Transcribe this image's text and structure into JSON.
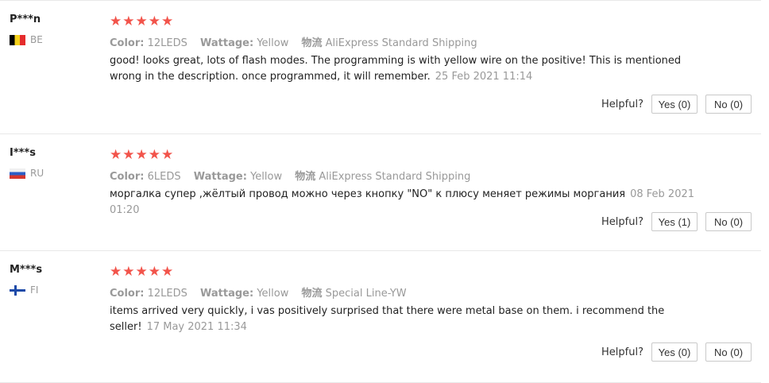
{
  "reviews": [
    {
      "user": "P***n",
      "country": "BE",
      "stars": "★★★★★",
      "color_label": "Color:",
      "color_value": "12LEDS",
      "wattage_label": "Wattage:",
      "wattage_value": "Yellow",
      "shipping_label": "物流",
      "shipping_value": "AliExpress Standard Shipping",
      "text": "good! looks great, lots of flash modes. The programming is with yellow wire on the positive! This is mentioned wrong in the description. once programmed, it will remember.",
      "date": "25 Feb 2021 11:14",
      "helpful_label": "Helpful?",
      "yes_label": "Yes (0)",
      "no_label": "No (0)"
    },
    {
      "user": "I***s",
      "country": "RU",
      "stars": "★★★★★",
      "color_label": "Color:",
      "color_value": "6LEDS",
      "wattage_label": "Wattage:",
      "wattage_value": "Yellow",
      "shipping_label": "物流",
      "shipping_value": "AliExpress Standard Shipping",
      "text": "моргалка супер ,жёлтый провод можно через кнопку \"NO\" к плюсу меняет режимы моргания",
      "date": "08 Feb 2021 01:20",
      "helpful_label": "Helpful?",
      "yes_label": "Yes (1)",
      "no_label": "No (0)"
    },
    {
      "user": "M***s",
      "country": "FI",
      "stars": "★★★★★",
      "color_label": "Color:",
      "color_value": "12LEDS",
      "wattage_label": "Wattage:",
      "wattage_value": "Yellow",
      "shipping_label": "物流",
      "shipping_value": "Special Line-YW",
      "text": "items arrived very quickly, i vas positively surprised that there were metal base on them. i recommend the seller!",
      "date": "17 May 2021 11:34",
      "helpful_label": "Helpful?",
      "yes_label": "Yes (0)",
      "no_label": "No (0)"
    }
  ]
}
